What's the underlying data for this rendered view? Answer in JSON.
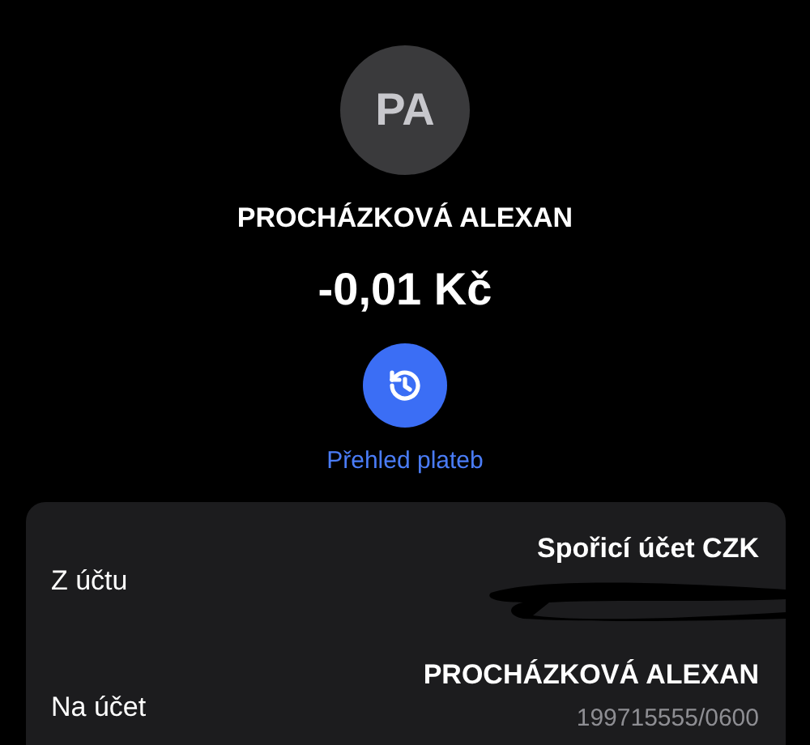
{
  "header": {
    "initials": "PA",
    "name": "PROCHÁZKOVÁ ALEXAN",
    "amount": "-0,01 Kč"
  },
  "history_link": {
    "label": "Přehled plateb"
  },
  "details": [
    {
      "kind": "redacted",
      "label": "Z účtu",
      "value": "Spořicí účet CZK"
    },
    {
      "kind": "account",
      "label": "Na účet",
      "value": "PROCHÁZKOVÁ ALEXAN",
      "subvalue": "199715555/0600"
    }
  ]
}
